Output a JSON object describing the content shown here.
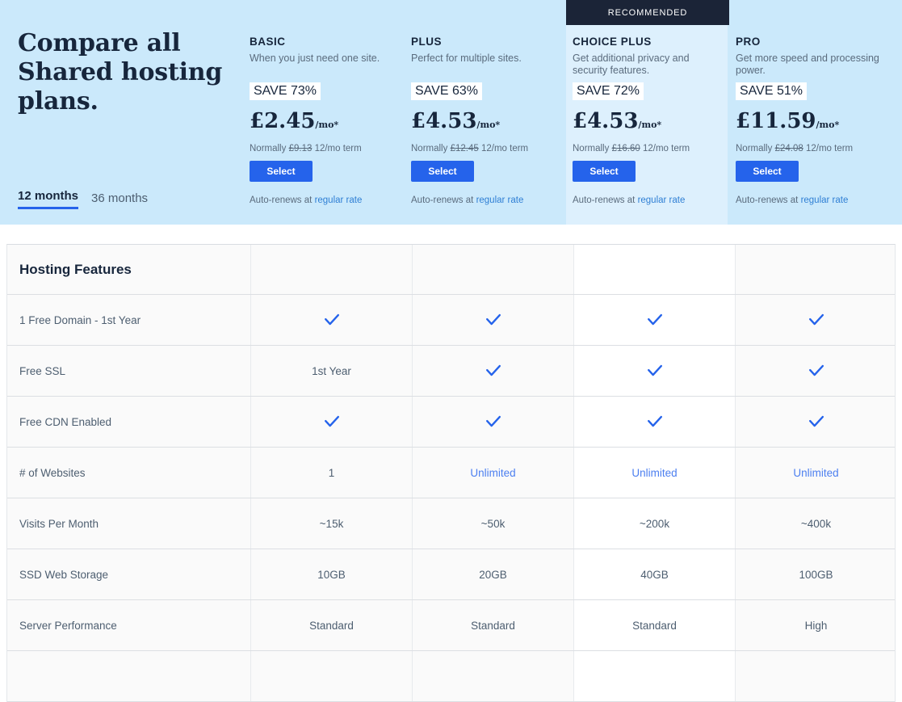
{
  "hero": {
    "title": "Compare all Shared hosting plans.",
    "term_tabs": [
      {
        "label": "12 months",
        "active": true
      },
      {
        "label": "36 months",
        "active": false
      }
    ],
    "recommended_label": "RECOMMENDED"
  },
  "plans": [
    {
      "name": "BASIC",
      "tagline": "When you just need one site.",
      "save": "SAVE 73%",
      "price": "£2.45",
      "per": "/mo*",
      "normally_prefix": "Normally",
      "normally_price": "£9.13",
      "normally_suffix": "12/mo term",
      "select_label": "Select",
      "autorenew_prefix": "Auto-renews at",
      "autorenew_link": "regular rate",
      "featured": false
    },
    {
      "name": "PLUS",
      "tagline": "Perfect for multiple sites.",
      "save": "SAVE 63%",
      "price": "£4.53",
      "per": "/mo*",
      "normally_prefix": "Normally",
      "normally_price": "£12.45",
      "normally_suffix": "12/mo term",
      "select_label": "Select",
      "autorenew_prefix": "Auto-renews at",
      "autorenew_link": "regular rate",
      "featured": false
    },
    {
      "name": "CHOICE PLUS",
      "tagline": "Get additional privacy and security features.",
      "save": "SAVE 72%",
      "price": "£4.53",
      "per": "/mo*",
      "normally_prefix": "Normally",
      "normally_price": "£16.60",
      "normally_suffix": "12/mo term",
      "select_label": "Select",
      "autorenew_prefix": "Auto-renews at",
      "autorenew_link": "regular rate",
      "featured": true
    },
    {
      "name": "PRO",
      "tagline": "Get more speed and processing power.",
      "save": "SAVE 51%",
      "price": "£11.59",
      "per": "/mo*",
      "normally_prefix": "Normally",
      "normally_price": "£24.08",
      "normally_suffix": "12/mo term",
      "select_label": "Select",
      "autorenew_prefix": "Auto-renews at",
      "autorenew_link": "regular rate",
      "featured": false
    }
  ],
  "table": {
    "header_label": "Hosting Features",
    "rows": [
      {
        "label": "1 Free Domain - 1st Year",
        "values": [
          "check",
          "check",
          "check",
          "check"
        ]
      },
      {
        "label": "Free SSL",
        "values": [
          "1st Year",
          "check",
          "check",
          "check"
        ]
      },
      {
        "label": "Free CDN Enabled",
        "values": [
          "check",
          "check",
          "check",
          "check"
        ]
      },
      {
        "label": "# of Websites",
        "values": [
          "1",
          "Unlimited",
          "Unlimited",
          "Unlimited"
        ]
      },
      {
        "label": "Visits Per Month",
        "values": [
          "~15k",
          "~50k",
          "~200k",
          "~400k"
        ]
      },
      {
        "label": "SSD Web Storage",
        "values": [
          "10GB",
          "20GB",
          "40GB",
          "100GB"
        ]
      },
      {
        "label": "Server Performance",
        "values": [
          "Standard",
          "Standard",
          "Standard",
          "High"
        ]
      },
      {
        "label": "",
        "values": [
          "",
          "",
          "",
          ""
        ]
      }
    ]
  },
  "colors": {
    "hero_bg": "#cbe9fb",
    "featured_bg": "#ddf0fd",
    "accent_blue": "#2563eb",
    "link_blue": "#2f7fd4",
    "unlimited_blue": "#4c7ff0",
    "navy": "#17263c",
    "banner_bg": "#1b2437"
  }
}
